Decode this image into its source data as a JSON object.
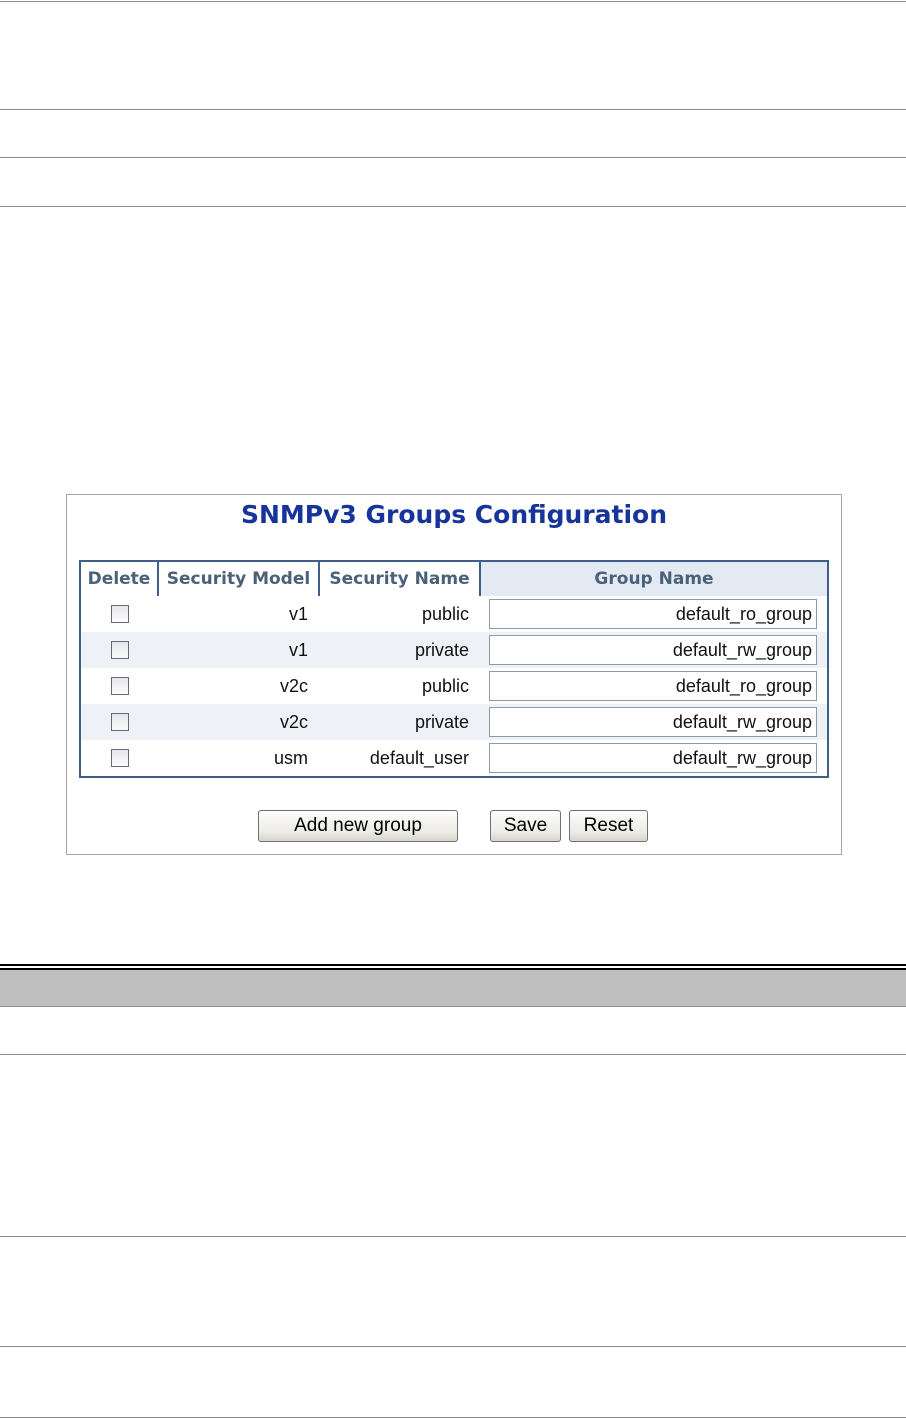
{
  "panel": {
    "title": "SNMPv3 Groups Configuration"
  },
  "table": {
    "headers": {
      "delete": "Delete",
      "security_model": "Security Model",
      "security_name": "Security Name",
      "group_name": "Group Name"
    },
    "rows": [
      {
        "security_model": "v1",
        "security_name": "public",
        "group_name": "default_ro_group"
      },
      {
        "security_model": "v1",
        "security_name": "private",
        "group_name": "default_rw_group"
      },
      {
        "security_model": "v2c",
        "security_name": "public",
        "group_name": "default_ro_group"
      },
      {
        "security_model": "v2c",
        "security_name": "private",
        "group_name": "default_rw_group"
      },
      {
        "security_model": "usm",
        "security_name": "default_user",
        "group_name": "default_rw_group"
      }
    ]
  },
  "buttons": {
    "add_new_group": "Add new group",
    "save": "Save",
    "reset": "Reset"
  }
}
